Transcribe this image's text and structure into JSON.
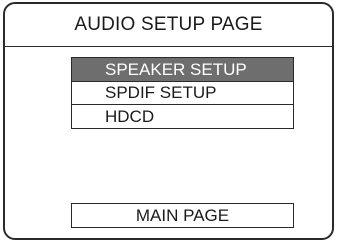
{
  "page": {
    "title": "AUDIO SETUP PAGE"
  },
  "menu": {
    "items": [
      {
        "label": "SPEAKER SETUP",
        "selected": true
      },
      {
        "label": "SPDIF SETUP",
        "selected": false
      },
      {
        "label": "HDCD",
        "selected": false
      }
    ]
  },
  "footer": {
    "main_page_label": "MAIN PAGE"
  },
  "colors": {
    "selected_bg": "#6e6e6e",
    "border": "#2a2a2a",
    "background": "#ffffff"
  }
}
